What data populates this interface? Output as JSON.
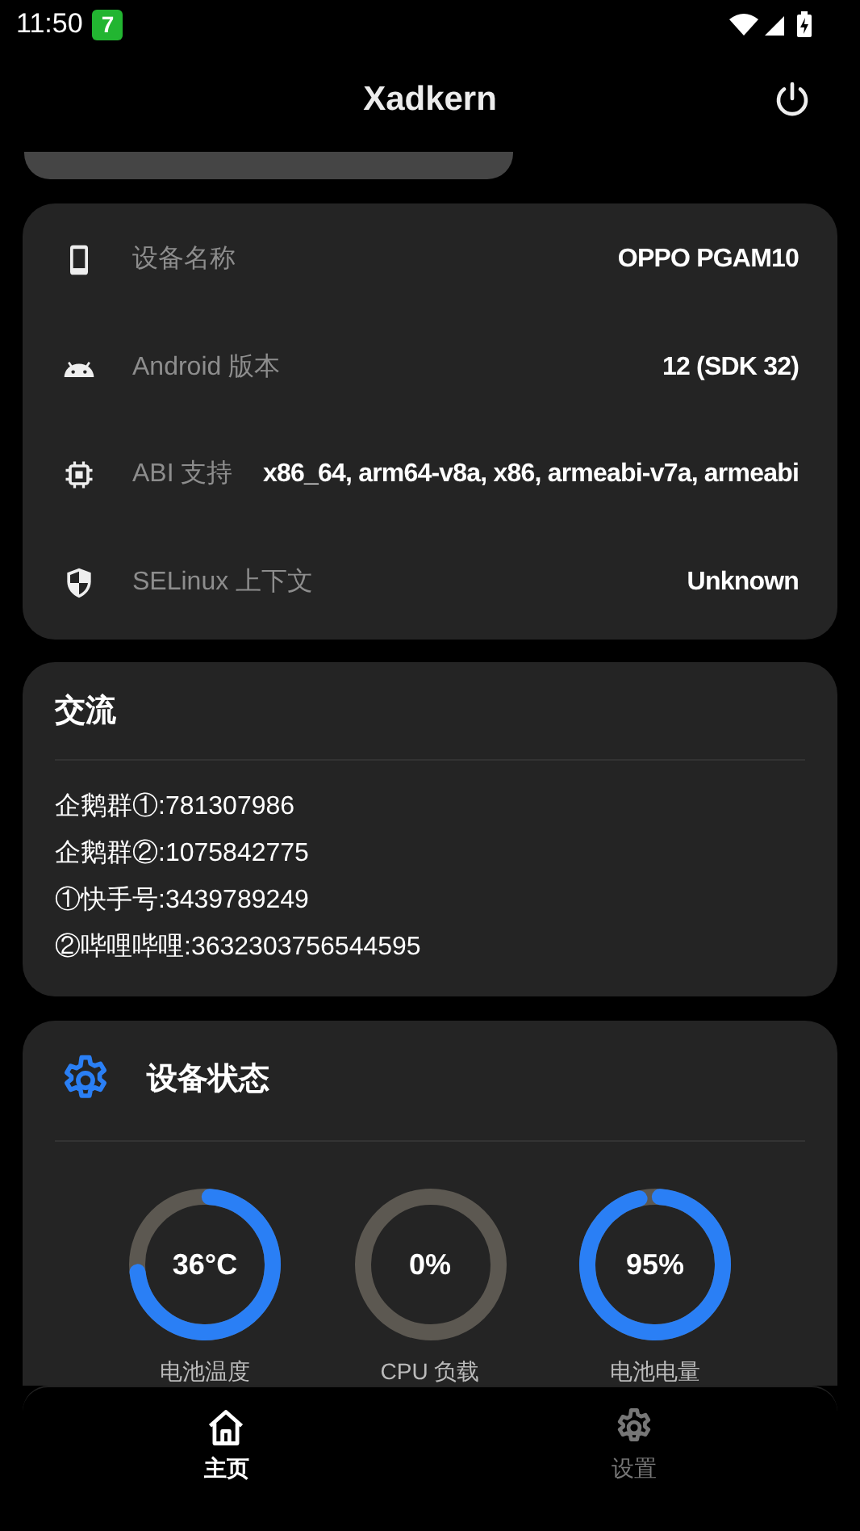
{
  "status_bar": {
    "time": "11:50",
    "notification_badge": "7"
  },
  "app_bar": {
    "title": "Xadkern"
  },
  "device_info": [
    {
      "kind": "phone",
      "label": "设备名称",
      "value": "OPPO PGAM10"
    },
    {
      "kind": "android",
      "label": "Android 版本",
      "value": "12 (SDK 32)"
    },
    {
      "kind": "chip",
      "label": "ABI 支持",
      "value": "x86_64, arm64-v8a, x86, armeabi-v7a, armeabi"
    },
    {
      "kind": "shield",
      "label": "SELinux 上下文",
      "value": "Unknown"
    }
  ],
  "community": {
    "title": "交流",
    "lines": [
      "企鹅群①:781307986",
      "企鹅群②:1075842775",
      "①快手号:3439789249",
      "②哔哩哔哩:3632303756544595"
    ]
  },
  "device_status": {
    "title": "设备状态",
    "gauges": [
      {
        "reading": "36°C",
        "label": "电池温度"
      },
      {
        "reading": "0%",
        "label": "CPU 负载"
      },
      {
        "reading": "95%",
        "label": "电池电量"
      }
    ]
  },
  "bottom_nav": [
    {
      "label": "主页",
      "kind": "home",
      "selected": true
    },
    {
      "label": "设置",
      "kind": "settings",
      "selected": false
    }
  ]
}
